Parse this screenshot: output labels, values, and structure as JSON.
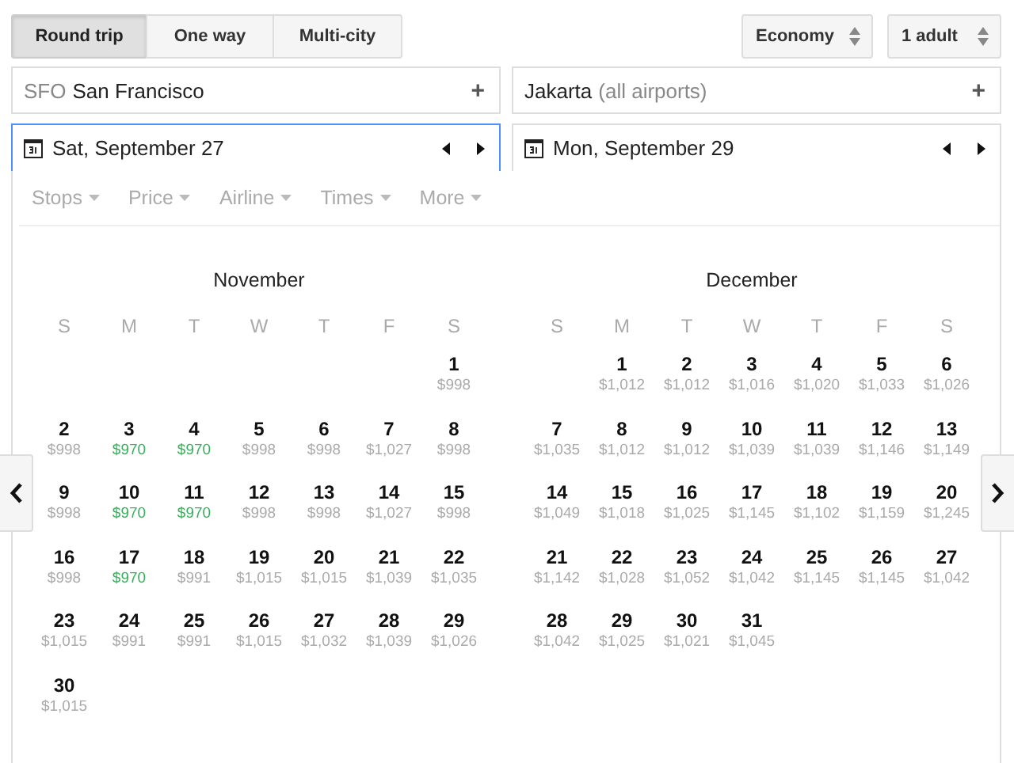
{
  "trip_types": [
    {
      "label": "Round trip",
      "selected": true
    },
    {
      "label": "One way",
      "selected": false
    },
    {
      "label": "Multi-city",
      "selected": false
    }
  ],
  "cabin_select": {
    "value": "Economy"
  },
  "passengers_select": {
    "value": "1 adult"
  },
  "origin": {
    "code": "SFO",
    "name": "San Francisco",
    "add": "+"
  },
  "destination": {
    "name": "Jakarta",
    "note": "(all airports)",
    "add": "+"
  },
  "departure": {
    "date": "Sat, September 27",
    "focused": true
  },
  "return": {
    "date": "Mon, September 29",
    "focused": false
  },
  "filters": [
    "Stops",
    "Price",
    "Airline",
    "Times",
    "More"
  ],
  "months": [
    {
      "name": "November",
      "weekdays": [
        "S",
        "M",
        "T",
        "W",
        "T",
        "F",
        "S"
      ],
      "weeks": [
        {
          "kind": "leading",
          "days": [
            {
              "day": "1",
              "price": "$998",
              "cheapest": false
            }
          ]
        },
        {
          "kind": "full",
          "days": [
            {
              "day": "2",
              "price": "$998",
              "cheapest": false
            },
            {
              "day": "3",
              "price": "$970",
              "cheapest": true
            },
            {
              "day": "4",
              "price": "$970",
              "cheapest": true
            },
            {
              "day": "5",
              "price": "$998",
              "cheapest": false
            },
            {
              "day": "6",
              "price": "$998",
              "cheapest": false
            },
            {
              "day": "7",
              "price": "$1,027",
              "cheapest": false
            },
            {
              "day": "8",
              "price": "$998",
              "cheapest": false
            }
          ]
        },
        {
          "kind": "full",
          "days": [
            {
              "day": "9",
              "price": "$998",
              "cheapest": false
            },
            {
              "day": "10",
              "price": "$970",
              "cheapest": true
            },
            {
              "day": "11",
              "price": "$970",
              "cheapest": true
            },
            {
              "day": "12",
              "price": "$998",
              "cheapest": false
            },
            {
              "day": "13",
              "price": "$998",
              "cheapest": false
            },
            {
              "day": "14",
              "price": "$1,027",
              "cheapest": false
            },
            {
              "day": "15",
              "price": "$998",
              "cheapest": false
            }
          ]
        },
        {
          "kind": "full",
          "days": [
            {
              "day": "16",
              "price": "$998",
              "cheapest": false
            },
            {
              "day": "17",
              "price": "$970",
              "cheapest": true
            },
            {
              "day": "18",
              "price": "$991",
              "cheapest": false
            },
            {
              "day": "19",
              "price": "$1,015",
              "cheapest": false
            },
            {
              "day": "20",
              "price": "$1,015",
              "cheapest": false
            },
            {
              "day": "21",
              "price": "$1,039",
              "cheapest": false
            },
            {
              "day": "22",
              "price": "$1,035",
              "cheapest": false
            }
          ]
        },
        {
          "kind": "full",
          "days": [
            {
              "day": "23",
              "price": "$1,015",
              "cheapest": false
            },
            {
              "day": "24",
              "price": "$991",
              "cheapest": false
            },
            {
              "day": "25",
              "price": "$991",
              "cheapest": false
            },
            {
              "day": "26",
              "price": "$1,015",
              "cheapest": false
            },
            {
              "day": "27",
              "price": "$1,032",
              "cheapest": false
            },
            {
              "day": "28",
              "price": "$1,039",
              "cheapest": false
            },
            {
              "day": "29",
              "price": "$1,026",
              "cheapest": false
            }
          ]
        },
        {
          "kind": "trailing",
          "days": [
            {
              "day": "30",
              "price": "$1,015",
              "cheapest": false
            }
          ]
        }
      ]
    },
    {
      "name": "December",
      "weekdays": [
        "S",
        "M",
        "T",
        "W",
        "T",
        "F",
        "S"
      ],
      "weeks": [
        {
          "kind": "leading",
          "days": [
            {
              "day": "1",
              "price": "$1,012",
              "cheapest": false
            },
            {
              "day": "2",
              "price": "$1,012",
              "cheapest": false
            },
            {
              "day": "3",
              "price": "$1,016",
              "cheapest": false
            },
            {
              "day": "4",
              "price": "$1,020",
              "cheapest": false
            },
            {
              "day": "5",
              "price": "$1,033",
              "cheapest": false
            },
            {
              "day": "6",
              "price": "$1,026",
              "cheapest": false
            }
          ]
        },
        {
          "kind": "full",
          "days": [
            {
              "day": "7",
              "price": "$1,035",
              "cheapest": false
            },
            {
              "day": "8",
              "price": "$1,012",
              "cheapest": false
            },
            {
              "day": "9",
              "price": "$1,012",
              "cheapest": false
            },
            {
              "day": "10",
              "price": "$1,039",
              "cheapest": false
            },
            {
              "day": "11",
              "price": "$1,039",
              "cheapest": false
            },
            {
              "day": "12",
              "price": "$1,146",
              "cheapest": false
            },
            {
              "day": "13",
              "price": "$1,149",
              "cheapest": false
            }
          ]
        },
        {
          "kind": "full",
          "days": [
            {
              "day": "14",
              "price": "$1,049",
              "cheapest": false
            },
            {
              "day": "15",
              "price": "$1,018",
              "cheapest": false
            },
            {
              "day": "16",
              "price": "$1,025",
              "cheapest": false
            },
            {
              "day": "17",
              "price": "$1,145",
              "cheapest": false
            },
            {
              "day": "18",
              "price": "$1,102",
              "cheapest": false
            },
            {
              "day": "19",
              "price": "$1,159",
              "cheapest": false
            },
            {
              "day": "20",
              "price": "$1,245",
              "cheapest": false
            }
          ]
        },
        {
          "kind": "full",
          "days": [
            {
              "day": "21",
              "price": "$1,142",
              "cheapest": false
            },
            {
              "day": "22",
              "price": "$1,028",
              "cheapest": false
            },
            {
              "day": "23",
              "price": "$1,052",
              "cheapest": false
            },
            {
              "day": "24",
              "price": "$1,042",
              "cheapest": false
            },
            {
              "day": "25",
              "price": "$1,145",
              "cheapest": false
            },
            {
              "day": "26",
              "price": "$1,145",
              "cheapest": false
            },
            {
              "day": "27",
              "price": "$1,042",
              "cheapest": false
            }
          ]
        },
        {
          "kind": "trailing",
          "days": [
            {
              "day": "28",
              "price": "$1,042",
              "cheapest": false
            },
            {
              "day": "29",
              "price": "$1,025",
              "cheapest": false
            },
            {
              "day": "30",
              "price": "$1,021",
              "cheapest": false
            },
            {
              "day": "31",
              "price": "$1,045",
              "cheapest": false
            }
          ]
        }
      ]
    }
  ]
}
